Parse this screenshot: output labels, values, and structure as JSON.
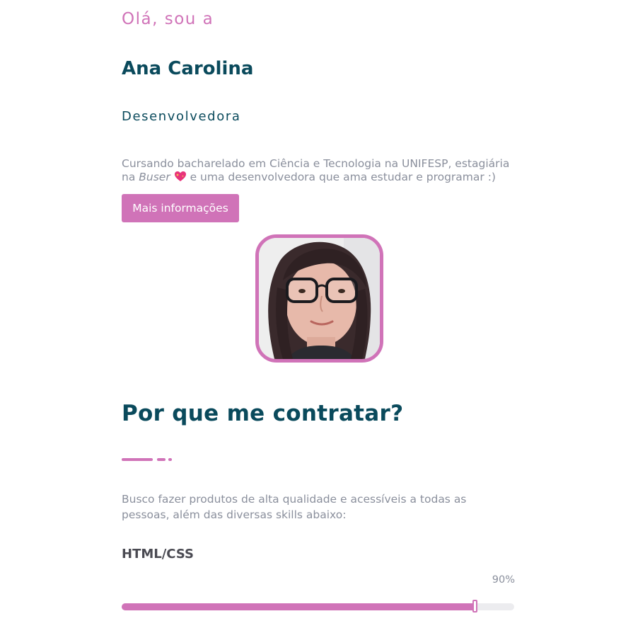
{
  "hero": {
    "greeting": "Olá, sou a",
    "name": "Ana Carolina",
    "role": "Desenvolvedora",
    "bio_part1": "Cursando bacharelado em Ciência e Tecnologia na UNIFESP, estagiária na ",
    "bio_company": "Buser",
    "bio_part2": " e uma desenvolvedora que ama estudar e programar :)",
    "heart_icon": "sparkling-heart-icon",
    "more_button": "Mais informações"
  },
  "colors": {
    "accent": "#d073b8",
    "heading": "#0a4a5c",
    "body_text": "#8a8f9c",
    "skill_title": "#4a4a52",
    "track": "#ececef"
  },
  "about": {
    "title": "Por que me contratar?",
    "intro": "Busco fazer produtos de alta qualidade e acessíveis a todas as pessoas, além das diversas skills abaixo:"
  },
  "skills": [
    {
      "name": "HTML/CSS",
      "percent_label": "90%",
      "percent": 90
    }
  ]
}
